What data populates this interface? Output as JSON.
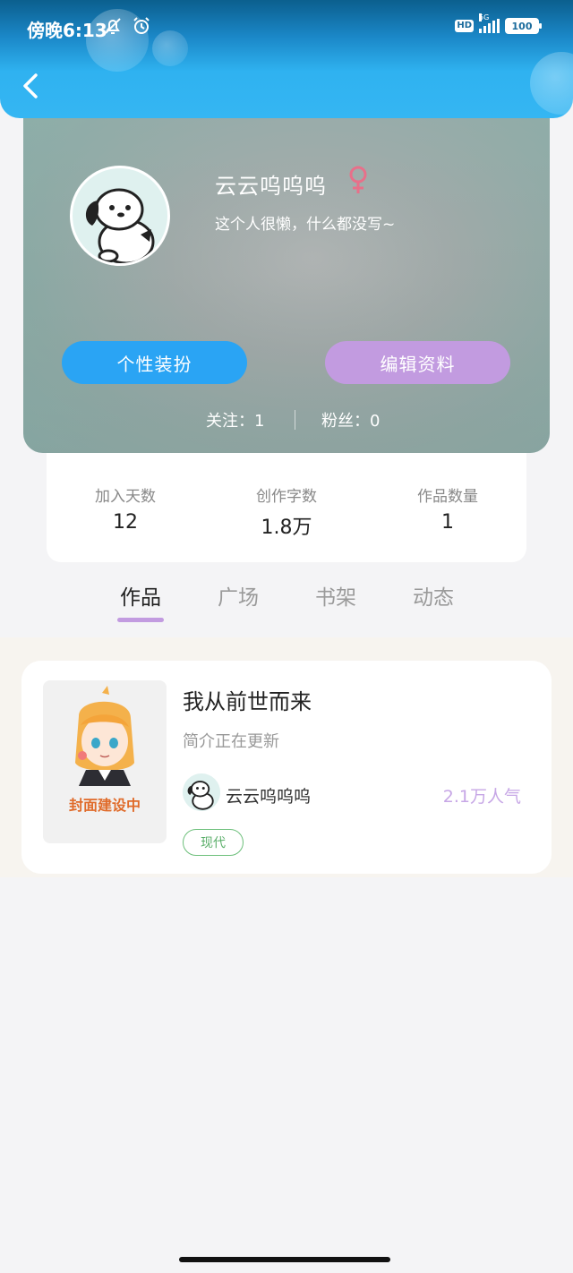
{
  "status_bar": {
    "time": "傍晚6:13",
    "hd": "HD",
    "network": "5G",
    "battery": "100"
  },
  "profile": {
    "nickname": "云云呜呜呜",
    "gender_symbol": "♀",
    "bio": "这个人很懒，什么都没写~",
    "buttons": {
      "dress_up": "个性装扮",
      "edit_profile": "编辑资料"
    },
    "following_label": "关注：1",
    "followers_label": "粉丝：0"
  },
  "stats": [
    {
      "label": "加入天数",
      "value": "12"
    },
    {
      "label": "创作字数",
      "value": "1.8万"
    },
    {
      "label": "作品数量",
      "value": "1"
    }
  ],
  "tabs": [
    {
      "label": "作品",
      "active": true
    },
    {
      "label": "广场",
      "active": false
    },
    {
      "label": "书架",
      "active": false
    },
    {
      "label": "动态",
      "active": false
    }
  ],
  "works": [
    {
      "cover_text": "封面建设中",
      "title": "我从前世而来",
      "description": "简介正在更新",
      "author": "云云呜呜呜",
      "popularity": "2.1万人气",
      "tag": "现代"
    }
  ],
  "colors": {
    "accent_blue": "#2aa4f4",
    "accent_purple": "#c29be0",
    "tag_green": "#5aae69"
  }
}
